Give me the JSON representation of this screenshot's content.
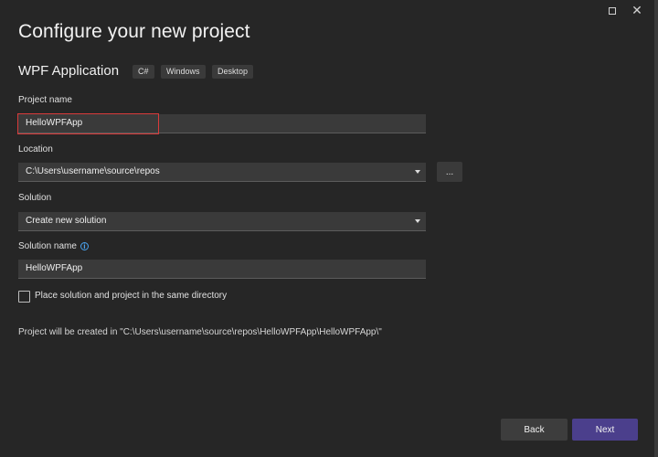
{
  "window": {
    "maximize_icon": "maximize-icon",
    "close_icon": "close-icon",
    "close_glyph": "✕"
  },
  "header": {
    "title": "Configure your new project"
  },
  "template": {
    "name": "WPF Application",
    "tags": [
      "C#",
      "Windows",
      "Desktop"
    ]
  },
  "project_name": {
    "label": "Project name",
    "value": "HelloWPFApp"
  },
  "location": {
    "label": "Location",
    "value": "C:\\Users\\username\\source\\repos",
    "browse_label": "..."
  },
  "solution": {
    "label": "Solution",
    "value": "Create new solution"
  },
  "solution_name": {
    "label": "Solution name",
    "value": "HelloWPFApp",
    "info_icon": "info-icon",
    "info_glyph": "i"
  },
  "same_directory": {
    "label": "Place solution and project in the same directory",
    "checked": false
  },
  "summary": "Project will be created in \"C:\\Users\\username\\source\\repos\\HelloWPFApp\\HelloWPFApp\\\"",
  "footer": {
    "back_label": "Back",
    "next_label": "Next"
  },
  "colors": {
    "accent": "#4b3f8c",
    "highlight": "#d93a3a",
    "info": "#4aa3ef",
    "background": "#262626"
  }
}
